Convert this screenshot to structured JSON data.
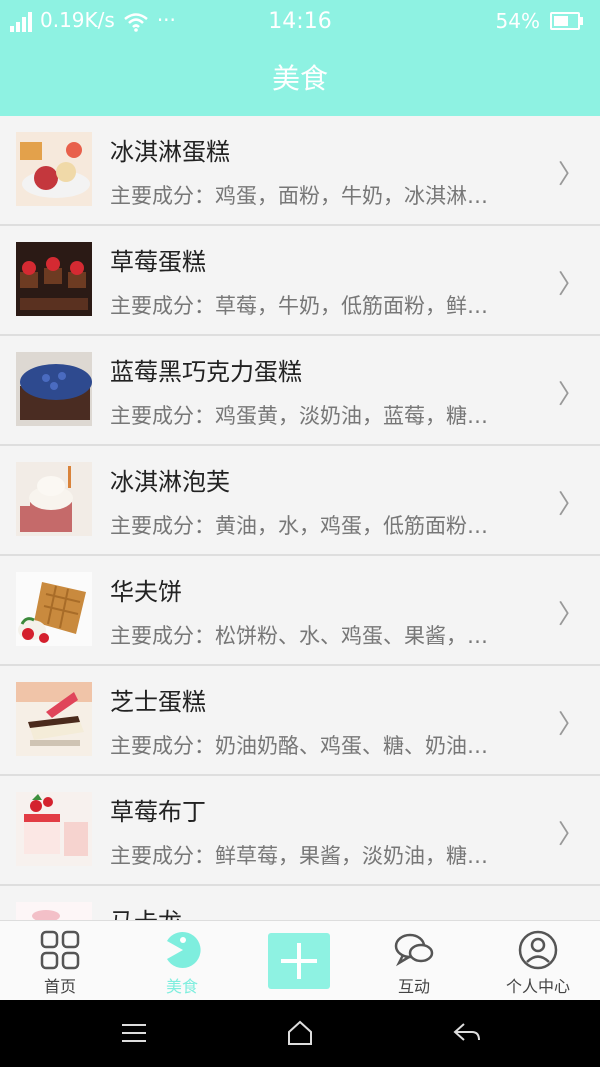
{
  "status": {
    "speed": "0.19K/s",
    "time": "14:16",
    "battery": "54%",
    "battery_level": 0.54
  },
  "header": {
    "title": "美食"
  },
  "items": [
    {
      "title": "冰淇淋蛋糕",
      "desc": "主要成分：鸡蛋，面粉，牛奶，冰淇淋…",
      "thumb": "icecream-cake"
    },
    {
      "title": "草莓蛋糕",
      "desc": "主要成分：草莓，牛奶，低筋面粉，鲜…",
      "thumb": "strawberry-cake"
    },
    {
      "title": "蓝莓黑巧克力蛋糕",
      "desc": "主要成分：鸡蛋黄，淡奶油，蓝莓，糖…",
      "thumb": "blueberry-cake"
    },
    {
      "title": "冰淇淋泡芙",
      "desc": "主要成分：黄油，水，鸡蛋，低筋面粉…",
      "thumb": "icecream-puff"
    },
    {
      "title": "华夫饼",
      "desc": "主要成分：松饼粉、水、鸡蛋、果酱，…",
      "thumb": "waffle"
    },
    {
      "title": "芝士蛋糕",
      "desc": "主要成分：奶油奶酪、鸡蛋、糖、奶油…",
      "thumb": "cheesecake"
    },
    {
      "title": "草莓布丁",
      "desc": "主要成分：鲜草莓，果酱，淡奶油，糖…",
      "thumb": "strawberry-pudding"
    },
    {
      "title": "马卡龙",
      "desc": "",
      "thumb": "macaron"
    }
  ],
  "tabbar": {
    "home": "首页",
    "food": "美食",
    "add": "",
    "interact": "互动",
    "profile": "个人中心"
  },
  "colors": {
    "accent": "#8ef2e2",
    "active_tab": "#7eeede"
  }
}
